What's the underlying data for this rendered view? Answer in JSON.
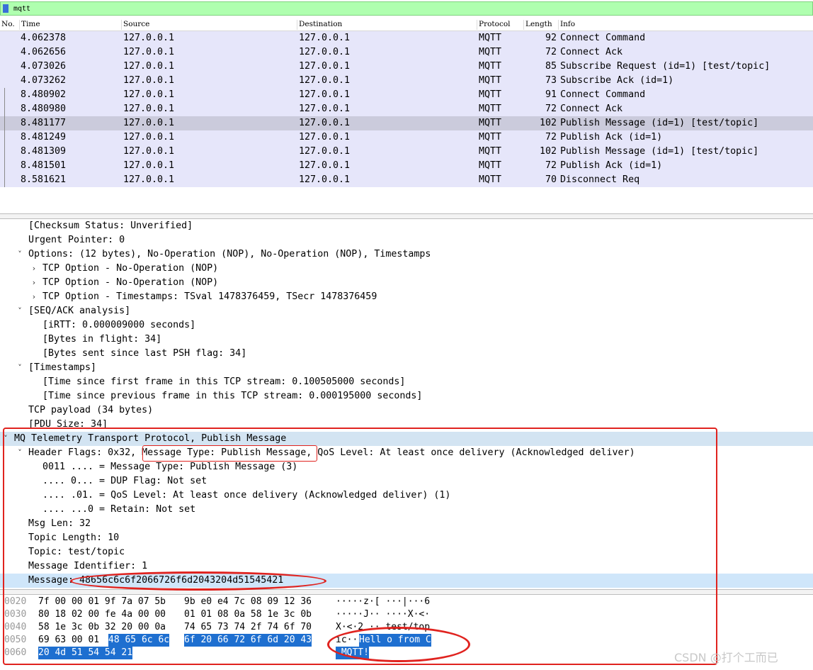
{
  "filter": {
    "value": "mqtt"
  },
  "packet_list": {
    "columns": [
      "No.",
      "Time",
      "Source",
      "Destination",
      "Protocol",
      "Length",
      "Info"
    ],
    "rows": [
      {
        "time": "4.062378",
        "src": "127.0.0.1",
        "dst": "127.0.0.1",
        "proto": "MQTT",
        "len": "92",
        "info": "Connect Command"
      },
      {
        "time": "4.062656",
        "src": "127.0.0.1",
        "dst": "127.0.0.1",
        "proto": "MQTT",
        "len": "72",
        "info": "Connect Ack"
      },
      {
        "time": "4.073026",
        "src": "127.0.0.1",
        "dst": "127.0.0.1",
        "proto": "MQTT",
        "len": "85",
        "info": "Subscribe Request (id=1) [test/topic]"
      },
      {
        "time": "4.073262",
        "src": "127.0.0.1",
        "dst": "127.0.0.1",
        "proto": "MQTT",
        "len": "73",
        "info": "Subscribe Ack (id=1)"
      },
      {
        "time": "8.480902",
        "src": "127.0.0.1",
        "dst": "127.0.0.1",
        "proto": "MQTT",
        "len": "91",
        "info": "Connect Command"
      },
      {
        "time": "8.480980",
        "src": "127.0.0.1",
        "dst": "127.0.0.1",
        "proto": "MQTT",
        "len": "72",
        "info": "Connect Ack"
      },
      {
        "time": "8.481177",
        "src": "127.0.0.1",
        "dst": "127.0.0.1",
        "proto": "MQTT",
        "len": "102",
        "info": "Publish Message (id=1) [test/topic]"
      },
      {
        "time": "8.481249",
        "src": "127.0.0.1",
        "dst": "127.0.0.1",
        "proto": "MQTT",
        "len": "72",
        "info": "Publish Ack (id=1)"
      },
      {
        "time": "8.481309",
        "src": "127.0.0.1",
        "dst": "127.0.0.1",
        "proto": "MQTT",
        "len": "102",
        "info": "Publish Message (id=1) [test/topic]"
      },
      {
        "time": "8.481501",
        "src": "127.0.0.1",
        "dst": "127.0.0.1",
        "proto": "MQTT",
        "len": "72",
        "info": "Publish Ack (id=1)"
      },
      {
        "time": "8.581621",
        "src": "127.0.0.1",
        "dst": "127.0.0.1",
        "proto": "MQTT",
        "len": "70",
        "info": "Disconnect Req"
      }
    ]
  },
  "details": {
    "lines": [
      {
        "arrow": "",
        "text": "[Checksum Status: Unverified]"
      },
      {
        "arrow": "",
        "text": "Urgent Pointer: 0"
      },
      {
        "arrow": "down",
        "text": "Options: (12 bytes), No-Operation (NOP), No-Operation (NOP), Timestamps"
      },
      {
        "arrow": "right",
        "text": "TCP Option - No-Operation (NOP)"
      },
      {
        "arrow": "right",
        "text": "TCP Option - No-Operation (NOP)"
      },
      {
        "arrow": "right",
        "text": "TCP Option - Timestamps: TSval 1478376459, TSecr 1478376459"
      },
      {
        "arrow": "down",
        "text": "[SEQ/ACK analysis]"
      },
      {
        "arrow": "",
        "text": "[iRTT: 0.000009000 seconds]"
      },
      {
        "arrow": "",
        "text": "[Bytes in flight: 34]"
      },
      {
        "arrow": "",
        "text": "[Bytes sent since last PSH flag: 34]"
      },
      {
        "arrow": "down",
        "text": "[Timestamps]"
      },
      {
        "arrow": "",
        "text": "[Time since first frame in this TCP stream: 0.100505000 seconds]"
      },
      {
        "arrow": "",
        "text": "[Time since previous frame in this TCP stream: 0.000195000 seconds]"
      },
      {
        "arrow": "",
        "text": "TCP payload (34 bytes)"
      },
      {
        "arrow": "",
        "text": "[PDU Size: 34]"
      },
      {
        "arrow": "down",
        "text": "MQ Telemetry Transport Protocol, Publish Message"
      },
      {
        "arrow": "down",
        "text": "Header Flags: 0x32, Message Type: Publish Message, QoS Level: At least once delivery (Acknowledged deliver)"
      },
      {
        "arrow": "",
        "text": "0011 .... = Message Type: Publish Message (3)"
      },
      {
        "arrow": "",
        "text": ".... 0... = DUP Flag: Not set"
      },
      {
        "arrow": "",
        "text": ".... .01. = QoS Level: At least once delivery (Acknowledged deliver) (1)"
      },
      {
        "arrow": "",
        "text": ".... ...0 = Retain: Not set"
      },
      {
        "arrow": "",
        "text": "Msg Len: 32"
      },
      {
        "arrow": "",
        "text": "Topic Length: 10"
      },
      {
        "arrow": "",
        "text": "Topic: test/topic"
      },
      {
        "arrow": "",
        "text": "Message Identifier: 1"
      },
      {
        "arrow": "",
        "text": "Message: 48656c6c6f2066726f6d2043204d51545421"
      }
    ]
  },
  "hexdump": {
    "rows": [
      {
        "offset": "0020",
        "b1": "7f 00 00 01 9f 7a 07 5b",
        "b2": "9b e0 e4 7c 08 09 12 36",
        "ascii": "·····z·[ ···|···6"
      },
      {
        "offset": "0030",
        "b1": "80 18 02 00 fe 4a 00 00",
        "b2": "01 01 08 0a 58 1e 3c 0b",
        "ascii": "·····J·· ····X·<·"
      },
      {
        "offset": "0040",
        "b1": "58 1e 3c 0b 32 20 00 0a",
        "b2": "74 65 73 74 2f 74 6f 70",
        "ascii": "X·<·2 ·· test/top"
      },
      {
        "offset": "0050",
        "b1": "69 63 00 01",
        "b1sel": "48 65 6c 6c",
        "b2": "6f 20 66 72 6f 6d 20 43",
        "ascii": "ic··",
        "asciisel": "Hell o from C"
      },
      {
        "offset": "0060",
        "b1sel": "20 4d 51 54 54 21",
        "asciisel": " MQTT!"
      }
    ]
  },
  "watermark": "CSDN @打个工而已",
  "colors": {
    "filter_bg": "#afffaf",
    "row_bg": "#e6e6fa",
    "row_selected": "#cbcbdc",
    "hex_select": "#1e6fd0",
    "annotation": "#e0231f"
  }
}
